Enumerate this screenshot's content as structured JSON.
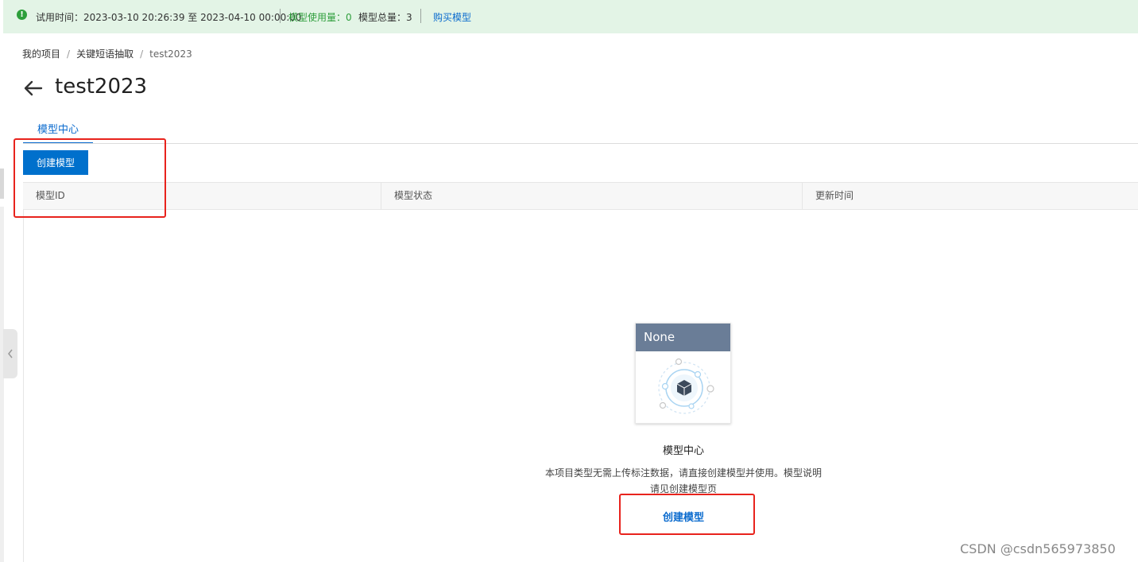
{
  "banner": {
    "trial_time": "试用时间：2023-03-10 20:26:39 至 2023-04-10 00:00:00",
    "model_usage": "模型使用量：0",
    "model_total": "模型总量：3",
    "buy_link": "购买模型",
    "colors": {
      "background": "#e3f4e6",
      "accent": "#2e9e3c",
      "link": "#0b6bce"
    }
  },
  "breadcrumb": {
    "items": [
      "我的项目",
      "关键短语抽取",
      "test2023"
    ],
    "separator": "/"
  },
  "header": {
    "back_icon": "arrow-left-icon",
    "title": "test2023"
  },
  "tabs": [
    {
      "label": "模型中心",
      "active": true
    }
  ],
  "toolbar": {
    "create_label": "创建模型"
  },
  "table": {
    "columns": [
      "模型ID",
      "模型状态",
      "更新时间"
    ],
    "rows": []
  },
  "empty_state": {
    "card_header": "None",
    "illustration_icon": "model-cube-icon",
    "title": "模型中心",
    "description_line1": "本项目类型无需上传标注数据，请直接创建模型并使用。模型说明",
    "description_line2": "请见创建模型页",
    "action_label": "创建模型"
  },
  "watermark": "CSDN @csdn565973850",
  "theme": {
    "primary": "#0070cc",
    "annotation_red": "#e8231d"
  }
}
